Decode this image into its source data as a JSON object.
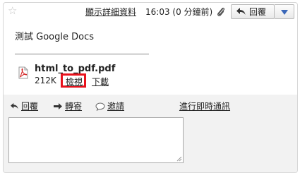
{
  "header": {
    "show_details": "顯示詳細資料",
    "timestamp": "16:03 (0 分鐘前)",
    "reply_label": "回覆"
  },
  "message": {
    "body": "測試 Google Docs"
  },
  "attachment": {
    "filename": "html_to_pdf.pdf",
    "size": "212K",
    "view_label": "檢視",
    "download_label": "下載"
  },
  "actions": {
    "reply": "回覆",
    "forward": "轉寄",
    "invite": "邀請",
    "invite_suffix": "進行即時通訊"
  },
  "colors": {
    "highlight_border": "#e8131d",
    "dropdown_arrow": "#3a67b8"
  }
}
